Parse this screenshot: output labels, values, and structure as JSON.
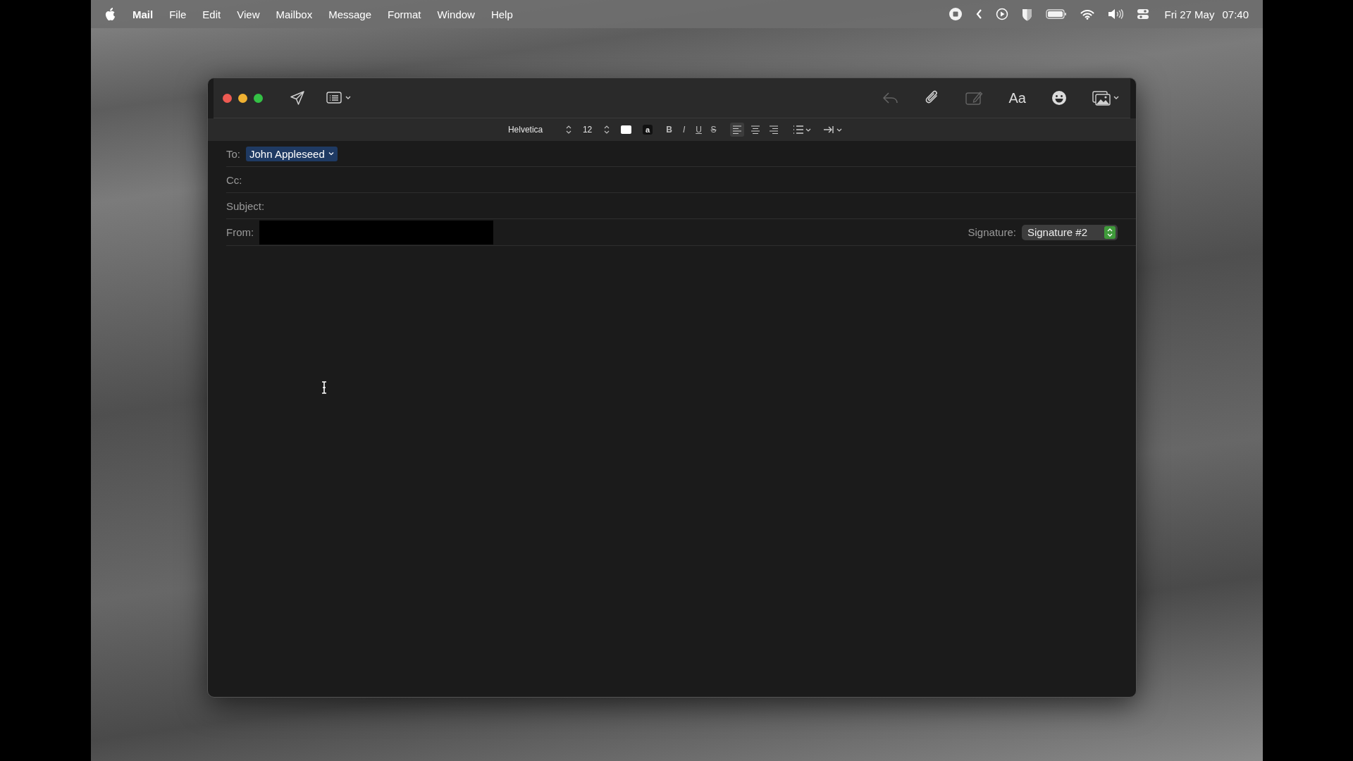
{
  "menu_bar": {
    "app_name": "Mail",
    "items": [
      "File",
      "Edit",
      "View",
      "Mailbox",
      "Message",
      "Format",
      "Window",
      "Help"
    ],
    "date": "Fri 27 May",
    "time": "07:40"
  },
  "toolbar": {
    "left_buttons": [
      {
        "kind": "send",
        "disabled": false
      },
      {
        "kind": "header",
        "disabled": false
      }
    ],
    "right_buttons": [
      {
        "kind": "reply",
        "disabled": true
      },
      {
        "kind": "attach",
        "disabled": false
      },
      {
        "kind": "markup",
        "disabled": true
      },
      {
        "kind": "fonts",
        "label": "Aa",
        "disabled": false
      },
      {
        "kind": "emoji",
        "disabled": false
      },
      {
        "kind": "photo",
        "disabled": false
      }
    ]
  },
  "format_bar": {
    "font": "Helvetica",
    "size": "12",
    "highlight_label": "a",
    "styles": [
      {
        "kind": "bold",
        "label": "B"
      },
      {
        "kind": "italic",
        "label": "I"
      },
      {
        "kind": "underline",
        "label": "U"
      },
      {
        "kind": "strike",
        "label": "S"
      }
    ],
    "alignments": [
      {
        "kind": "left",
        "selected": true
      },
      {
        "kind": "center",
        "selected": false
      },
      {
        "kind": "right",
        "selected": false
      }
    ]
  },
  "to": {
    "label": "To:",
    "recipients": [
      "John Appleseed"
    ]
  },
  "cc": {
    "label": "Cc:"
  },
  "subject": {
    "label": "Subject:"
  },
  "from": {
    "label": "From:"
  },
  "signature": {
    "label": "Signature:",
    "value": "Signature #2"
  }
}
